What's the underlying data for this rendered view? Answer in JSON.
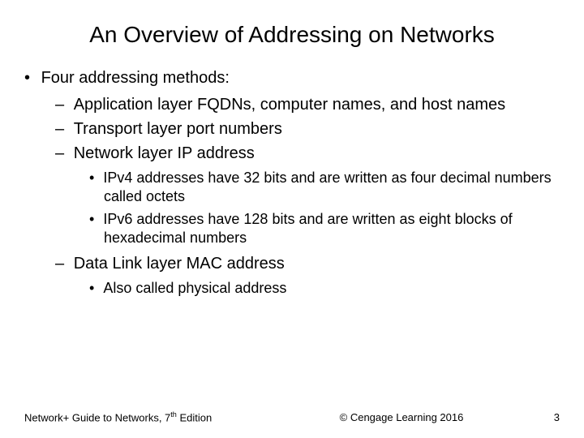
{
  "title": "An Overview of Addressing on Networks",
  "intro": "Four addressing methods:",
  "methods": {
    "m1": "Application layer FQDNs, computer names, and host names",
    "m2": "Transport layer port numbers",
    "m3": "Network layer IP address",
    "m3_sub1": "IPv4 addresses have 32 bits and are written as four decimal numbers called octets",
    "m3_sub2": "IPv6 addresses have 128 bits and are written as eight blocks of hexadecimal numbers",
    "m4": "Data Link layer MAC address",
    "m4_sub1": "Also called physical address"
  },
  "footer": {
    "left_prefix": "Network+ Guide to Networks, 7",
    "left_suffix": " Edition",
    "left_sup": "th",
    "center": "© Cengage Learning  2016",
    "page": "3"
  }
}
